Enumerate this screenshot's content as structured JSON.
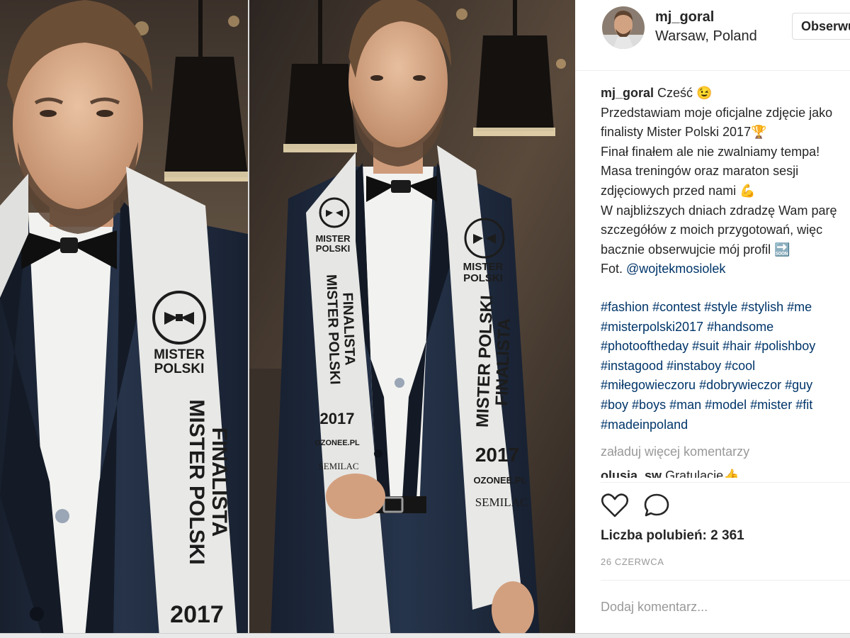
{
  "post": {
    "username": "mj_goral",
    "location": "Warsaw, Poland",
    "follow_label": "Obserwuj",
    "caption_lines": [
      "Cześć 😉",
      "Przedstawiam moje oficjalne zdjęcie jako",
      "finalisty Mister Polski 2017🏆",
      "Finał finałem ale nie zwalniamy tempa!",
      "Masa treningów oraz maraton sesji",
      "zdjęciowych przed nami 💪",
      "W najbliższych dniach zdradzę Wam parę",
      "szczegółów z moich przygotowań, więc",
      "bacznie obserwujcie mój profil 🔜"
    ],
    "photo_credit_prefix": "Fot. ",
    "photo_credit_mention": "@wojtekmosiolek",
    "hashtag_lines": [
      [
        "#fashion",
        "#contest",
        "#style",
        "#stylish",
        "#me"
      ],
      [
        "#misterpolski2017",
        "#handsome"
      ],
      [
        "#photooftheday",
        "#suit",
        "#hair",
        "#polishboy"
      ],
      [
        "#instagood",
        "#instaboy",
        "#cool"
      ],
      [
        "#miłegowieczoru",
        "#dobrywieczor",
        "#guy"
      ],
      [
        "#boy",
        "#boys",
        "#man",
        "#model",
        "#mister",
        "#fit"
      ],
      [
        "#madeinpoland"
      ]
    ],
    "load_more_label": "załaduj więcej komentarzy",
    "peek_comment": {
      "user": "olusia_sw",
      "text": "Gratulacje👍"
    },
    "likes_label": "Liczba polubień: 2 361",
    "date_label": "26 CZERWCA",
    "comment_placeholder": "Dodaj komentarz..."
  },
  "sash": {
    "brand_line1": "MISTER",
    "brand_line2": "POLSKI",
    "title_line1": "MISTER POLSKI",
    "title_line2": "FINALISTA",
    "year": "2017",
    "sponsor1": "OZONEE.PL",
    "sponsor2": "SEMILAC"
  },
  "icons": {
    "like": "heart-icon",
    "comment": "speech-bubble-icon"
  },
  "colors": {
    "text": "#262626",
    "link": "#003569",
    "muted": "#999999",
    "border": "#dbdbdb",
    "suit": "#1e2a3d",
    "sash": "#e8e8e6"
  }
}
